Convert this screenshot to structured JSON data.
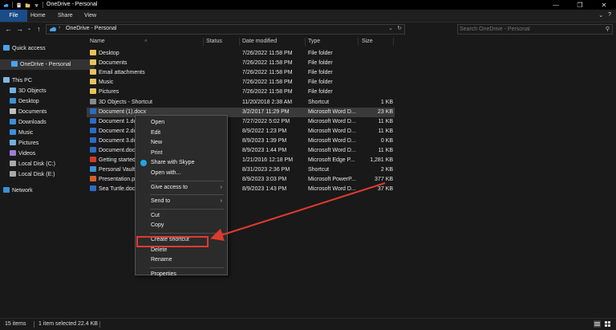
{
  "window": {
    "title": "OneDrive - Personal",
    "controls": [
      "—",
      "❐",
      "✕"
    ]
  },
  "ribbon": {
    "tabs": [
      "File",
      "Home",
      "Share",
      "View"
    ]
  },
  "address": {
    "path": "OneDrive - Personal",
    "search_placeholder": "Search OneDrive - Personal"
  },
  "sidebar": {
    "items": [
      {
        "label": "Quick access",
        "icon": "star-icon",
        "color": "#4aa3f0"
      },
      {
        "label": "OneDrive - Personal",
        "icon": "onedrive-icon",
        "color": "#4aa3f0"
      },
      {
        "label": "This PC",
        "icon": "pc-icon",
        "color": "#7fb7e8"
      },
      {
        "label": "3D Objects",
        "icon": "cube-icon",
        "color": "#6fb3e0"
      },
      {
        "label": "Desktop",
        "icon": "desktop-icon",
        "color": "#3c8fd8"
      },
      {
        "label": "Documents",
        "icon": "documents-icon",
        "color": "#bfbfbf"
      },
      {
        "label": "Downloads",
        "icon": "download-icon",
        "color": "#3c8fd8"
      },
      {
        "label": "Music",
        "icon": "music-icon",
        "color": "#3c8fd8"
      },
      {
        "label": "Pictures",
        "icon": "pictures-icon",
        "color": "#6fb3e0"
      },
      {
        "label": "Videos",
        "icon": "videos-icon",
        "color": "#9a7fd8"
      },
      {
        "label": "Local Disk (C:)",
        "icon": "drive-icon",
        "color": "#aaaaaa"
      },
      {
        "label": "Local Disk (E:)",
        "icon": "drive-icon",
        "color": "#aaaaaa"
      },
      {
        "label": "Network",
        "icon": "network-icon",
        "color": "#3c8fd8"
      }
    ]
  },
  "columns": {
    "name": "Name",
    "status": "Status",
    "date": "Date modified",
    "type": "Type",
    "size": "Size"
  },
  "files": [
    {
      "name": "Desktop",
      "date": "7/26/2022 11:58 PM",
      "type": "File folder",
      "size": "",
      "icon": "folder"
    },
    {
      "name": "Documents",
      "date": "7/26/2022 11:58 PM",
      "type": "File folder",
      "size": "",
      "icon": "folder"
    },
    {
      "name": "Email attachments",
      "date": "7/26/2022 11:58 PM",
      "type": "File folder",
      "size": "",
      "icon": "folder"
    },
    {
      "name": "Music",
      "date": "7/26/2022 11:58 PM",
      "type": "File folder",
      "size": "",
      "icon": "folder"
    },
    {
      "name": "Pictures",
      "date": "7/26/2022 11:58 PM",
      "type": "File folder",
      "size": "",
      "icon": "folder"
    },
    {
      "name": "3D Objects - Shortcut",
      "date": "11/20/2018 2:38 AM",
      "type": "Shortcut",
      "size": "1 KB",
      "icon": "lnk"
    },
    {
      "name": "Document (1).docx",
      "date": "3/2/2017 11:29 PM",
      "type": "Microsoft Word D...",
      "size": "23 KB",
      "icon": "doc"
    },
    {
      "name": "Document 1.do",
      "date": "7/27/2022 5:02 PM",
      "type": "Microsoft Word D...",
      "size": "11 KB",
      "icon": "doc"
    },
    {
      "name": "Document 2.dc",
      "date": "8/9/2022 1:23 PM",
      "type": "Microsoft Word D...",
      "size": "11 KB",
      "icon": "doc"
    },
    {
      "name": "Document 3.dc",
      "date": "8/9/2023 1:39 PM",
      "type": "Microsoft Word D...",
      "size": "0 KB",
      "icon": "doc"
    },
    {
      "name": "Document.doc",
      "date": "8/9/2023 1:44 PM",
      "type": "Microsoft Word D...",
      "size": "11 KB",
      "icon": "doc"
    },
    {
      "name": "Getting started",
      "date": "1/21/2016 12:18 PM",
      "type": "Microsoft Edge P...",
      "size": "1,281 KB",
      "icon": "pdf"
    },
    {
      "name": "Personal Vault",
      "date": "8/31/2023 2:36 PM",
      "type": "Shortcut",
      "size": "2 KB",
      "icon": "vault"
    },
    {
      "name": "Presentation.pp",
      "date": "8/9/2023 3:03 PM",
      "type": "Microsoft PowerP...",
      "size": "377 KB",
      "icon": "ppt"
    },
    {
      "name": "Sea Turtle.docx",
      "date": "8/9/2023 1:43 PM",
      "type": "Microsoft Word D...",
      "size": "37 KB",
      "icon": "doc"
    }
  ],
  "context_menu": {
    "items": [
      {
        "label": "Open",
        "arrow": false
      },
      {
        "label": "Edit",
        "arrow": false
      },
      {
        "label": "New",
        "arrow": false
      },
      {
        "label": "Print",
        "arrow": false
      },
      {
        "label": "Share with Skype",
        "arrow": false,
        "skype": true
      },
      {
        "label": "Open with...",
        "arrow": false
      },
      {
        "sep": true
      },
      {
        "label": "Give access to",
        "arrow": true
      },
      {
        "sep": true
      },
      {
        "label": "Send to",
        "arrow": true
      },
      {
        "sep": true
      },
      {
        "label": "Cut",
        "arrow": false
      },
      {
        "label": "Copy",
        "arrow": false
      },
      {
        "sep": true
      },
      {
        "label": "Create shortcut",
        "arrow": false
      },
      {
        "label": "Delete",
        "arrow": false
      },
      {
        "label": "Rename",
        "arrow": false
      },
      {
        "sep": true
      },
      {
        "label": "Properties",
        "arrow": false
      }
    ]
  },
  "status": {
    "count": "15 items",
    "selected": "1 item selected  22.4 KB"
  },
  "annotation_color": "#e03a2f"
}
